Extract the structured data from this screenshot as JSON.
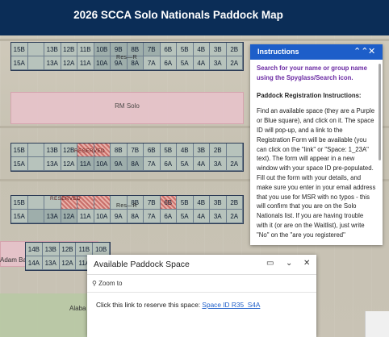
{
  "header": {
    "title": "2026 SCCA Solo Nationals Paddock Map"
  },
  "rows": [
    {
      "top": [
        "15B",
        "",
        "13B",
        "12B",
        "11B",
        "10B",
        "9B",
        "8B",
        "7B",
        "6B",
        "5B",
        "4B",
        "3B",
        "2B"
      ],
      "bottom": [
        "15A",
        "",
        "13A",
        "12A",
        "11A",
        "10A",
        "9A",
        "8A",
        "7A",
        "6A",
        "5A",
        "4A",
        "3A",
        "2A"
      ],
      "label": "Res—R"
    },
    {
      "top": [
        "15B",
        "",
        "13B",
        "12B",
        "",
        "",
        "8B",
        "7B",
        "6B",
        "5B",
        "4B",
        "3B",
        "2B"
      ],
      "bottom": [
        "15A",
        "",
        "13A",
        "12A",
        "11A",
        "10A",
        "9A",
        "8A",
        "7A",
        "6A",
        "5A",
        "4A",
        "3A",
        "2A"
      ],
      "label": "RESERVED"
    },
    {
      "top": [
        "15B",
        "",
        "",
        "",
        "",
        "",
        "",
        "8B",
        "7B",
        "6B",
        "5B",
        "4B",
        "3B",
        "2B"
      ],
      "bottom": [
        "15A",
        "",
        "13A",
        "12A",
        "11A",
        "10A",
        "9A",
        "8A",
        "7A",
        "6A",
        "5A",
        "4A",
        "3A",
        "2A"
      ],
      "label": "RESERVED",
      "label2": "Res—R"
    },
    {
      "top": [
        "14B",
        "13B",
        "12B",
        "11B",
        "10B"
      ],
      "bottom": [
        "14A",
        "13A",
        "12A",
        "11A",
        "10A"
      ]
    }
  ],
  "zones": {
    "rm_solo": "RM Solo",
    "adam_barber": "Adam Barber",
    "alabama": "Alaba"
  },
  "lastrow_visible": [
    "4A",
    "3A",
    "2A"
  ],
  "instructions": {
    "title": "Instructions",
    "intro": "Search for your name or group name using the Spyglass/Search icon.",
    "heading": "Paddock Registration Instructions:",
    "body": "Find an available space (they are a Purple or Blue square), and click on it. The space ID will pop-up, and a link to the Registration Form will be available (you can click on the \"link\" or \"Space: 1_23A\" text). The form will appear in a new window with your space ID pre-populated. Fill out the form with your details, and make sure you enter in your email address that you use for MSR with no typos - this will confirm that you are on the Solo Nationals list. If you are having trouble with it (or are on the Waitlist), just write \"No\" on the \"are you registered\""
  },
  "popup": {
    "title": "Available Paddock Space",
    "zoom_label": "Zoom to",
    "message": "Click this link to reserve this space:",
    "link": "Space ID R35_S4A"
  }
}
